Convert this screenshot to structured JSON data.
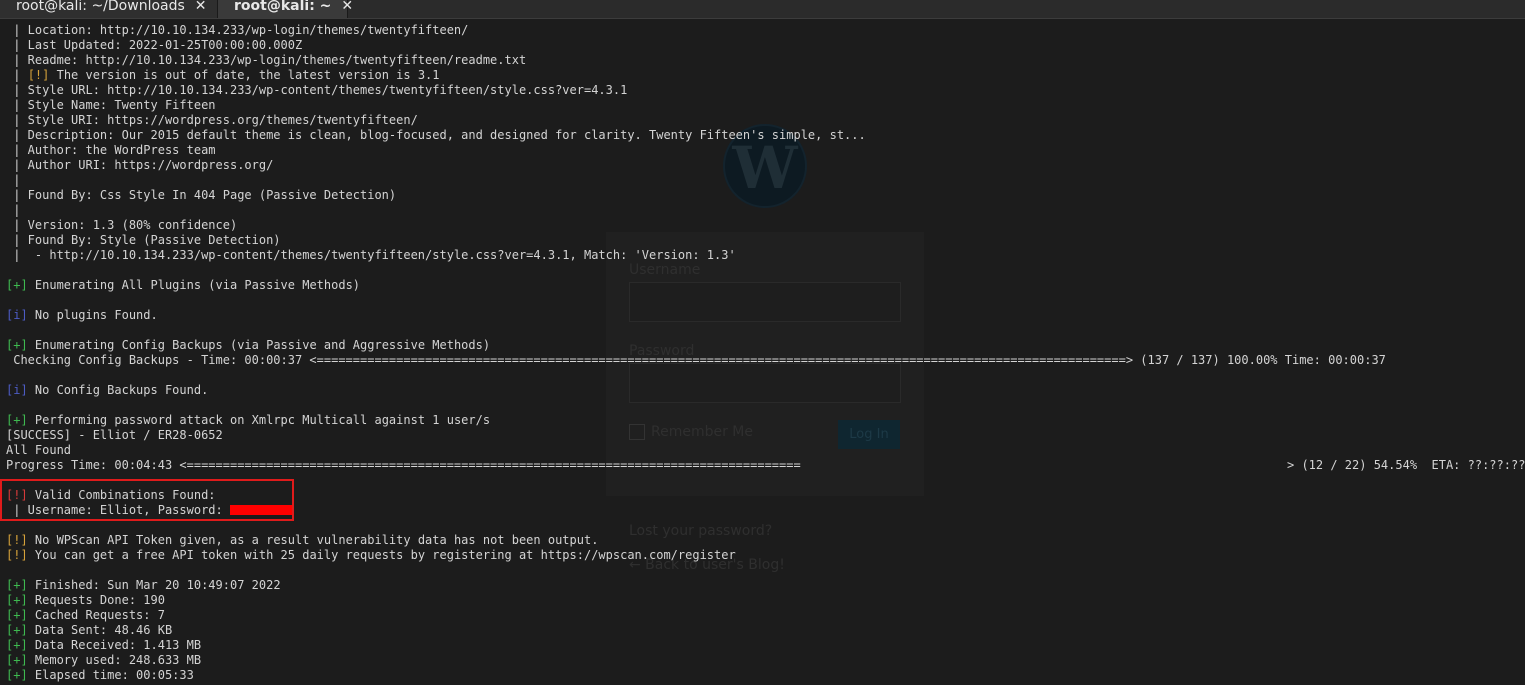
{
  "tabs": [
    {
      "label": "root@kali: ~/Downloads",
      "close": "✕"
    },
    {
      "label": "root@kali: ~",
      "close": "✕"
    }
  ],
  "background_page": {
    "username_label": "Username",
    "password_label": "Password",
    "remember_label": "Remember Me",
    "login_button": "Log In",
    "lost_password": "Lost your password?",
    "back_link": "← Back to user's Blog!"
  },
  "terminal": {
    "lines": [
      " | Location: http://10.10.134.233/wp-login/themes/twentyfifteen/",
      " | Last Updated: 2022-01-25T00:00:00.000Z",
      " | Readme: http://10.10.134.233/wp-login/themes/twentyfifteen/readme.txt",
      {
        "tag": "[!]",
        "text": " The version is out of date, the latest version is 3.1",
        "prefix": " | "
      },
      " | Style URL: http://10.10.134.233/wp-content/themes/twentyfifteen/style.css?ver=4.3.1",
      " | Style Name: Twenty Fifteen",
      " | Style URI: https://wordpress.org/themes/twentyfifteen/",
      " | Description: Our 2015 default theme is clean, blog-focused, and designed for clarity. Twenty Fifteen's simple, st...",
      " | Author: the WordPress team",
      " | Author URI: https://wordpress.org/",
      " |",
      " | Found By: Css Style In 404 Page (Passive Detection)",
      " |",
      " | Version: 1.3 (80% confidence)",
      " | Found By: Style (Passive Detection)",
      " |  - http://10.10.134.233/wp-content/themes/twentyfifteen/style.css?ver=4.3.1, Match: 'Version: 1.3'",
      "",
      {
        "tag": "[+]",
        "text": " Enumerating All Plugins (via Passive Methods)"
      },
      "",
      {
        "tag": "[i]",
        "text": " No plugins Found."
      },
      "",
      {
        "tag": "[+]",
        "text": " Enumerating Config Backups (via Passive and Aggressive Methods)"
      },
      {
        "text": " Checking Config Backups - Time: 00:00:37 <================================================================================================================> (137 / 137) 100.00% Time: 00:00:37"
      },
      "",
      {
        "tag": "[i]",
        "text": " No Config Backups Found."
      },
      "",
      {
        "tag": "[+]",
        "text": " Performing password attack on Xmlrpc Multicall against 1 user/s"
      },
      "[SUCCESS] - Elliot / ER28-0652",
      "All Found",
      {
        "text": "Progress Time: 00:04:43 <=====================================================================================",
        "right": "> (12 / 22) 54.54%  ETA: ??:??:??"
      },
      "",
      {
        "tag": "[!]",
        "tagclass": "bang",
        "text": " Valid Combinations Found:"
      },
      {
        "text": " | Username: Elliot, Password: ",
        "redacted": true
      },
      "",
      {
        "tag": "[!]",
        "text": " No WPScan API Token given, as a result vulnerability data has not been output."
      },
      {
        "tag": "[!]",
        "text": " You can get a free API token with 25 daily requests by registering at https://wpscan.com/register"
      },
      "",
      {
        "tag": "[+]",
        "text": " Finished: Sun Mar 20 10:49:07 2022"
      },
      {
        "tag": "[+]",
        "text": " Requests Done: 190"
      },
      {
        "tag": "[+]",
        "text": " Cached Requests: 7"
      },
      {
        "tag": "[+]",
        "text": " Data Sent: 48.46 KB"
      },
      {
        "tag": "[+]",
        "text": " Data Received: 1.413 MB"
      },
      {
        "tag": "[+]",
        "text": " Memory used: 248.633 MB"
      },
      {
        "tag": "[+]",
        "text": " Elapsed time: 00:05:33"
      }
    ]
  },
  "colors": {
    "plus": "#3fb950",
    "info": "#4d5cc4",
    "warn": "#d6a23a",
    "bang": "#d63a3a",
    "highlight": "#e01b1b"
  }
}
